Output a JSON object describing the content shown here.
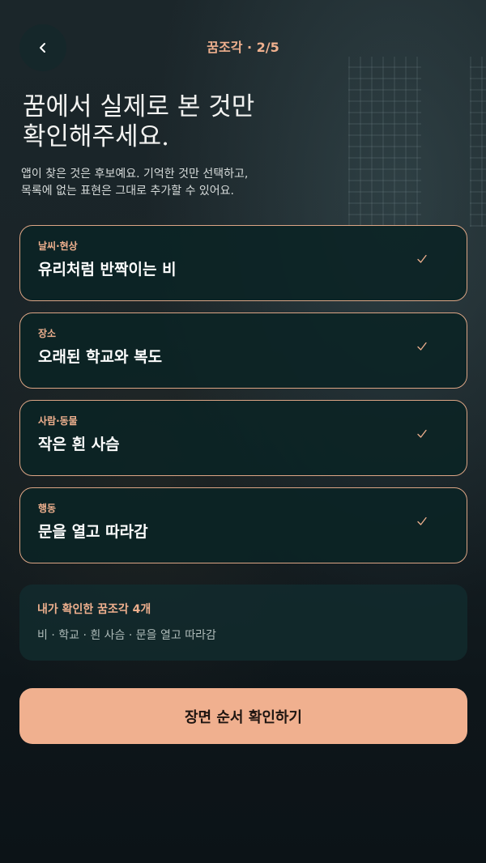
{
  "header": {
    "title": "꿈조각 · 2/5",
    "back_icon": "chevron-left-icon"
  },
  "title": "꿈에서 실제로 본 것만\n확인해주세요.",
  "subtitle": "앱이 찾은 것은 후보예요. 기억한 것만 선택하고,\n목록에 없는 표현은 그대로 추가할 수 있어요.",
  "cards": [
    {
      "category": "날씨·현상",
      "value": "유리처럼 반짝이는 비",
      "checked": true
    },
    {
      "category": "장소",
      "value": "오래된 학교와 복도",
      "checked": true
    },
    {
      "category": "사람·동물",
      "value": "작은 흰 사슴",
      "checked": true
    },
    {
      "category": "행동",
      "value": "문을 열고 따라감",
      "checked": true
    }
  ],
  "summary": {
    "title": "내가 확인한 꿈조각 4개",
    "text": "비 · 학교 · 흰 사슴 · 문을 열고 따라감"
  },
  "cta": {
    "label": "장면 순서 확인하기"
  },
  "colors": {
    "accent": "#efb08e",
    "button": "#f0b08f",
    "card_border": "#dca585",
    "card_bg": "#0b2425"
  }
}
